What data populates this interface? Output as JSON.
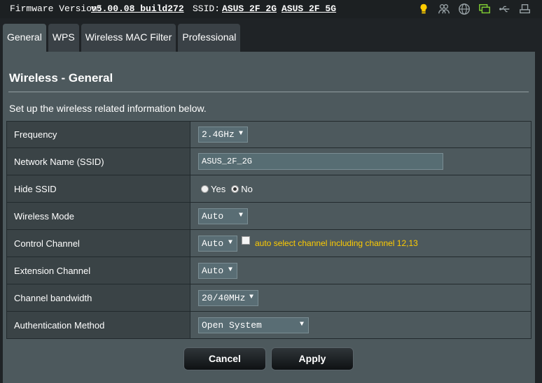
{
  "header": {
    "firmware_label": "Firmware Version:",
    "firmware_value": "v5.00.08_build272",
    "ssid_label": "SSID:",
    "ssid_2g": "ASUS_2F_2G",
    "ssid_5g": "ASUS_2F_5G",
    "status_icons": [
      "bulb-icon",
      "users-icon",
      "globe-icon",
      "monitor-icon",
      "usb-icon",
      "printer-icon"
    ]
  },
  "tabs": [
    {
      "label": "General",
      "active": true
    },
    {
      "label": "WPS"
    },
    {
      "label": "Wireless MAC Filter"
    },
    {
      "label": "Professional"
    }
  ],
  "page": {
    "title": "Wireless - General",
    "description": "Set up the wireless related information below."
  },
  "form": {
    "frequency": {
      "label": "Frequency",
      "value": "2.4GHz"
    },
    "ssid": {
      "label": "Network Name (SSID)",
      "value": "ASUS_2F_2G"
    },
    "hide_ssid": {
      "label": "Hide SSID",
      "yes": "Yes",
      "no": "No",
      "selected": "No"
    },
    "wireless_mode": {
      "label": "Wireless Mode",
      "value": "Auto"
    },
    "control_channel": {
      "label": "Control Channel",
      "value": "Auto",
      "note": "auto select channel including channel 12,13"
    },
    "extension_channel": {
      "label": "Extension Channel",
      "value": "Auto"
    },
    "bandwidth": {
      "label": "Channel bandwidth",
      "value": "20/40MHz"
    },
    "auth": {
      "label": "Authentication Method",
      "value": "Open System"
    }
  },
  "buttons": {
    "cancel": "Cancel",
    "apply": "Apply"
  },
  "colors": {
    "accent_yellow": "#ffcc00",
    "panel": "#4d595d",
    "label_cell": "#3a4346"
  }
}
